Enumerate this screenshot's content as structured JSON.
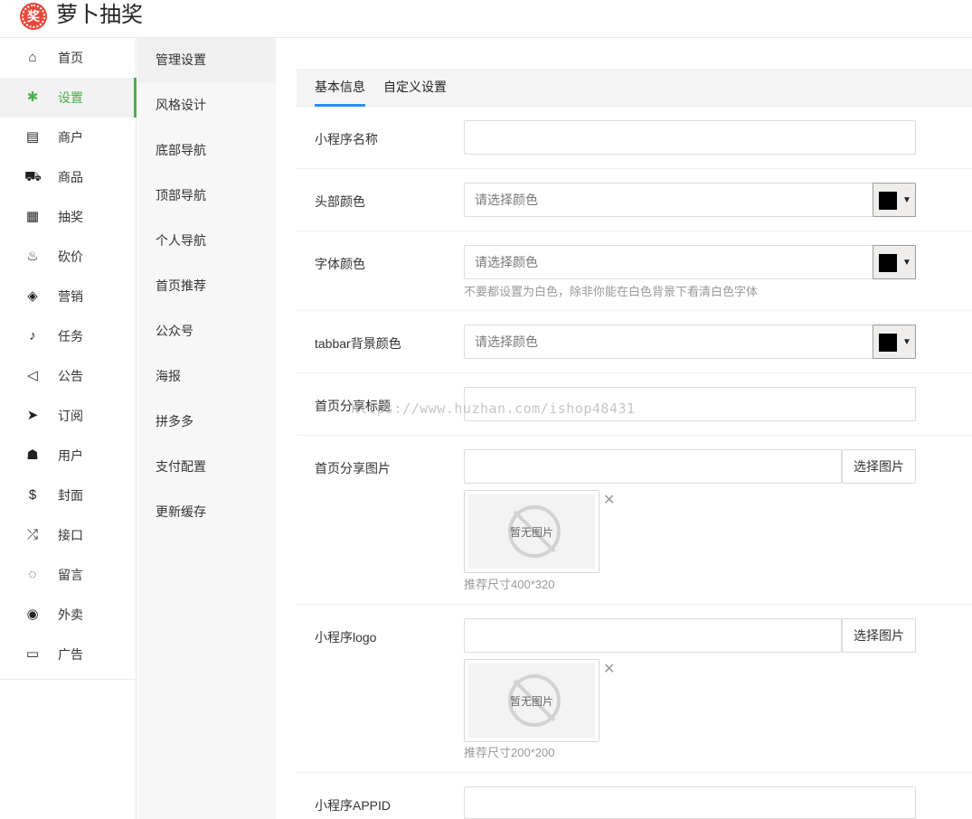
{
  "header": {
    "logo_char": "奖",
    "title": "萝卜抽奖"
  },
  "sidebar": {
    "items": [
      {
        "label": "首页",
        "icon": "⌂"
      },
      {
        "label": "设置",
        "icon": "✱"
      },
      {
        "label": "商户",
        "icon": "▤"
      },
      {
        "label": "商品",
        "icon": "⛟"
      },
      {
        "label": "抽奖",
        "icon": "▦"
      },
      {
        "label": "砍价",
        "icon": "♨"
      },
      {
        "label": "营销",
        "icon": "◈"
      },
      {
        "label": "任务",
        "icon": "♪"
      },
      {
        "label": "公告",
        "icon": "◁"
      },
      {
        "label": "订阅",
        "icon": "➤"
      },
      {
        "label": "用户",
        "icon": "☗"
      },
      {
        "label": "封面",
        "icon": "$"
      },
      {
        "label": "接口",
        "icon": "⤮"
      },
      {
        "label": "留言",
        "icon": "◌"
      },
      {
        "label": "外卖",
        "icon": "◉"
      },
      {
        "label": "广告",
        "icon": "▭"
      }
    ],
    "active_index": 1
  },
  "subnav": {
    "items": [
      "管理设置",
      "风格设计",
      "底部导航",
      "顶部导航",
      "个人导航",
      "首页推荐",
      "公众号",
      "海报",
      "拼多多",
      "支付配置",
      "更新缓存"
    ]
  },
  "tabs": [
    "基本信息",
    "自定义设置"
  ],
  "form": {
    "app_name": {
      "label": "小程序名称",
      "value": ""
    },
    "header_color": {
      "label": "头部颜色",
      "placeholder": "请选择颜色",
      "swatch": "#000000"
    },
    "font_color": {
      "label": "字体颜色",
      "placeholder": "请选择颜色",
      "swatch": "#000000",
      "hint": "不要都设置为白色，除非你能在白色背景下看清白色字体"
    },
    "tabbar_color": {
      "label": "tabbar背景颜色",
      "placeholder": "请选择颜色",
      "swatch": "#000000"
    },
    "share_title": {
      "label": "首页分享标题",
      "value": ""
    },
    "share_image": {
      "label": "首页分享图片",
      "button": "选择图片",
      "no_image": "暂无图片",
      "size_note": "推荐尺寸400*320"
    },
    "app_logo": {
      "label": "小程序logo",
      "button": "选择图片",
      "no_image": "暂无图片",
      "size_note": "推荐尺寸200*200"
    },
    "app_id": {
      "label": "小程序APPID",
      "value": ""
    }
  },
  "watermark": "https://www.huzhan.com/ishop48431",
  "dropdown_arrow": "▼",
  "delete_glyph": "✕"
}
